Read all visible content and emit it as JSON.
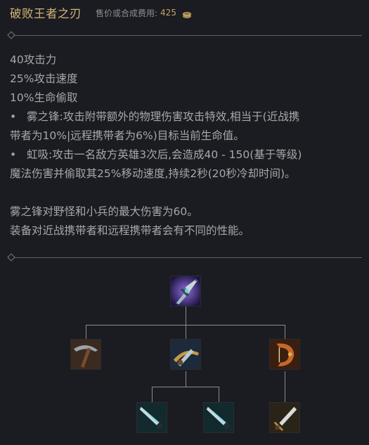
{
  "header": {
    "item_name": "破败王者之刃",
    "price_label": "售价或合成费用:",
    "price_value": "425",
    "coin_icon": "gold-coin-icon"
  },
  "description": {
    "stats": [
      "40攻击力",
      "25%攻击速度",
      "10%生命偷取"
    ],
    "passives": [
      {
        "bullet": "•",
        "line1": "雾之锋:攻击附带额外的物理伤害攻击特效,相当于(近战携",
        "line2": "带者为10%|远程携带者为6%)目标当前生命值。"
      },
      {
        "bullet": "•",
        "line1": "虹吸:攻击一名敌方英雄3次后,会造成40 - 150(基于等级)",
        "line2": "魔法伤害并偷取其25%移动速度,持续2秒(20秒冷却时间)。"
      }
    ],
    "notes": [
      "雾之锋对野怪和小兵的最大伤害为60。",
      "装备对近战携带者和远程携带者会有不同的性能。"
    ]
  },
  "build_tree": {
    "root": "blade-of-ruined-king-icon",
    "components": [
      "pickaxe-icon",
      "bilgewater-cutlass-icon",
      "recurve-bow-icon"
    ],
    "cutlass_components": [
      "long-sword-icon",
      "long-sword-icon"
    ],
    "bow_components": [
      "dagger-icon"
    ]
  },
  "colors": {
    "background": "#1a1c21",
    "title": "#d3b47a",
    "price": "#c4a267",
    "text": "#a7a8ab"
  }
}
